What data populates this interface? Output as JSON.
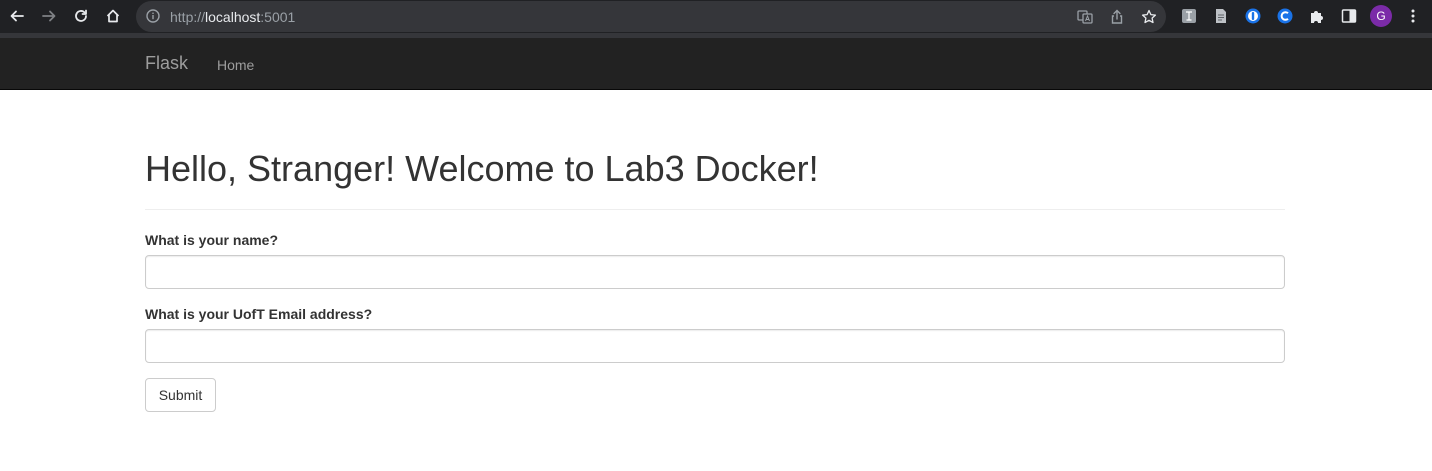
{
  "browser": {
    "url_scheme": "http://",
    "url_host": "localhost",
    "url_port": ":5001",
    "avatar_letter": "G",
    "avatar_color": "#7b2ba8"
  },
  "navbar": {
    "brand": "Flask",
    "links": [
      {
        "label": "Home"
      }
    ]
  },
  "page": {
    "heading": "Hello, Stranger! Welcome to Lab3 Docker!"
  },
  "form": {
    "name_label": "What is your name?",
    "name_value": "",
    "email_label": "What is your UofT Email address?",
    "email_value": "",
    "submit_label": "Submit"
  }
}
